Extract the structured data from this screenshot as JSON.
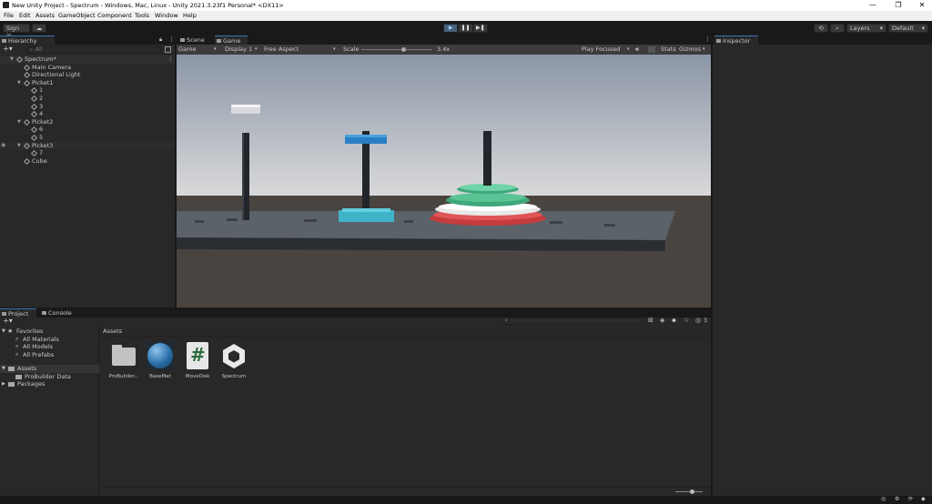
{
  "window": {
    "title": "New Unity Project - Spectrum - Windows, Mac, Linux - Unity 2021.3.23f1 Personal* <DX11>",
    "minimize": "—",
    "restore": "❐",
    "close": "✕"
  },
  "menu": [
    "File",
    "Edit",
    "Assets",
    "GameObject",
    "Component",
    "Tools",
    "Window",
    "Help"
  ],
  "toolbar": {
    "sign_in": "Sign in",
    "cloud_icon": "☁",
    "layers": "Layers",
    "layout": "Default",
    "history_icon": "⟲",
    "search_icon": "⌕"
  },
  "play_controls": {
    "play": "▶",
    "pause": "❚❚",
    "step": "▶❚"
  },
  "hierarchy": {
    "tab": "Hierarchy",
    "search_placeholder": "All",
    "add": "+▾",
    "rows": [
      {
        "label": "Spectrum*",
        "depth": 0,
        "arrow": "▼",
        "root": true
      },
      {
        "label": "Main Camera",
        "depth": 1,
        "arrow": ""
      },
      {
        "label": "Directional Light",
        "depth": 1,
        "arrow": ""
      },
      {
        "label": "Picket1",
        "depth": 1,
        "arrow": "▼"
      },
      {
        "label": "1",
        "depth": 2,
        "arrow": ""
      },
      {
        "label": "2",
        "depth": 2,
        "arrow": ""
      },
      {
        "label": "3",
        "depth": 2,
        "arrow": ""
      },
      {
        "label": "4",
        "depth": 2,
        "arrow": ""
      },
      {
        "label": "Picket2",
        "depth": 1,
        "arrow": "▼"
      },
      {
        "label": "6",
        "depth": 2,
        "arrow": ""
      },
      {
        "label": "5",
        "depth": 2,
        "arrow": ""
      },
      {
        "label": "Picket3",
        "depth": 1,
        "arrow": "▼",
        "selected": true
      },
      {
        "label": "7",
        "depth": 2,
        "arrow": ""
      },
      {
        "label": "Cube",
        "depth": 1,
        "arrow": ""
      }
    ]
  },
  "view": {
    "tabs": [
      "Scene",
      "Game"
    ],
    "active_tab": "Game",
    "game_dropdown": "Game",
    "display": "Display 1",
    "aspect": "Free Aspect",
    "scale_label": "Scale",
    "scale_value": "3.4x",
    "scale_fraction": 0.6,
    "play_focused": "Play Focused",
    "stats": "Stats",
    "gizmos": "Gizmos"
  },
  "inspector": {
    "tab": "Inspector"
  },
  "project": {
    "tabs": [
      "Project",
      "Console"
    ],
    "add": "+▾",
    "favorites_label": "Favorites",
    "favorites": [
      "All Materials",
      "All Models",
      "All Prefabs"
    ],
    "assets_label": "Assets",
    "asset_folders": [
      "ProBuilder Data"
    ],
    "packages_label": "Packages",
    "breadcrumb": "Assets",
    "hidden_count": "3",
    "assets": [
      {
        "name": "ProBuilder...",
        "kind": "folder-icon"
      },
      {
        "name": "BaseMat",
        "kind": "material-sphere-icon"
      },
      {
        "name": "MoveDisk",
        "kind": "csharp-script-icon",
        "glyph": "#"
      },
      {
        "name": "Spectrum",
        "kind": "unity-scene-icon"
      }
    ]
  },
  "colors": {
    "accent": "#3a72b0",
    "panel": "#282828",
    "sky_top": "#8c97a6",
    "sky_bottom": "#d7d7d8",
    "ground": "#4b4541",
    "board_top": "#5b6168",
    "board_side": "#2c3035",
    "disk_blue": "#2a7fc4",
    "disk_cyan": "#3fb4c8",
    "disk_green": "#3fa77c",
    "disk_white": "#e8e8e8",
    "disk_red": "#c53c3c"
  }
}
